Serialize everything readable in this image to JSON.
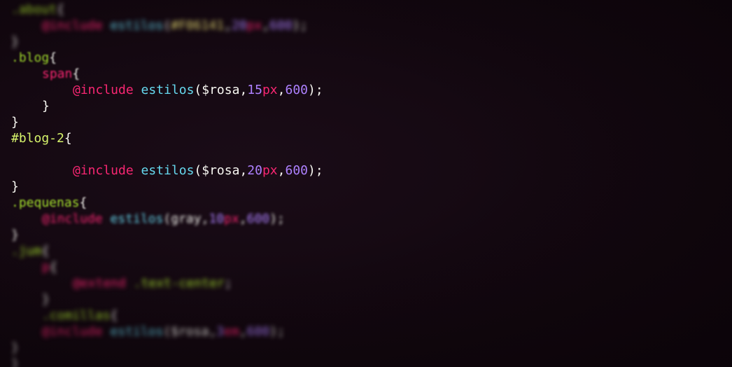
{
  "editor": {
    "lines": [
      {
        "indent": 0,
        "blur": "strong",
        "tokens": [
          {
            "t": ".about",
            "c": "sel"
          },
          {
            "t": "{",
            "c": "punc"
          }
        ]
      },
      {
        "indent": 1,
        "blur": "strong",
        "tokens": [
          {
            "t": "@include",
            "c": "at"
          },
          {
            "t": " ",
            "c": "punc"
          },
          {
            "t": "estilos",
            "c": "fn"
          },
          {
            "t": "(",
            "c": "punc"
          },
          {
            "t": "#F06141",
            "c": "str"
          },
          {
            "t": ",",
            "c": "punc"
          },
          {
            "t": "20",
            "c": "num"
          },
          {
            "t": "px",
            "c": "unit"
          },
          {
            "t": ",",
            "c": "punc"
          },
          {
            "t": "600",
            "c": "num"
          },
          {
            "t": ");",
            "c": "punc"
          }
        ]
      },
      {
        "indent": 0,
        "blur": "strong",
        "tokens": [
          {
            "t": "}",
            "c": "punc"
          }
        ]
      },
      {
        "indent": 0,
        "blur": "light",
        "tokens": [
          {
            "t": ".blog",
            "c": "sel"
          },
          {
            "t": "{",
            "c": "punc"
          }
        ]
      },
      {
        "indent": 1,
        "blur": "light",
        "tokens": [
          {
            "t": "span",
            "c": "tag"
          },
          {
            "t": "{",
            "c": "punc"
          }
        ]
      },
      {
        "indent": 2,
        "blur": "none",
        "tokens": [
          {
            "t": "@include",
            "c": "at"
          },
          {
            "t": " ",
            "c": "punc"
          },
          {
            "t": "estilos",
            "c": "fn"
          },
          {
            "t": "(",
            "c": "punc"
          },
          {
            "t": "$rosa",
            "c": "var"
          },
          {
            "t": ",",
            "c": "punc"
          },
          {
            "t": "15",
            "c": "num"
          },
          {
            "t": "px",
            "c": "unit"
          },
          {
            "t": ",",
            "c": "punc"
          },
          {
            "t": "600",
            "c": "num"
          },
          {
            "t": ");",
            "c": "punc"
          }
        ]
      },
      {
        "indent": 1,
        "blur": "none",
        "tokens": [
          {
            "t": "}",
            "c": "punc"
          }
        ]
      },
      {
        "indent": 0,
        "blur": "none",
        "tokens": [
          {
            "t": "}",
            "c": "punc"
          }
        ]
      },
      {
        "indent": 0,
        "blur": "none",
        "tokens": [
          {
            "t": "#blog-2",
            "c": "id"
          },
          {
            "t": "{",
            "c": "punc"
          }
        ]
      },
      {
        "indent": 2,
        "blur": "none",
        "tokens": []
      },
      {
        "indent": 2,
        "blur": "none",
        "tokens": [
          {
            "t": "@include",
            "c": "at"
          },
          {
            "t": " ",
            "c": "punc"
          },
          {
            "t": "estilos",
            "c": "fn"
          },
          {
            "t": "(",
            "c": "punc"
          },
          {
            "t": "$rosa",
            "c": "var"
          },
          {
            "t": ",",
            "c": "punc"
          },
          {
            "t": "20",
            "c": "num"
          },
          {
            "t": "px",
            "c": "unit"
          },
          {
            "t": ",",
            "c": "punc"
          },
          {
            "t": "600",
            "c": "num"
          },
          {
            "t": ");",
            "c": "punc"
          }
        ]
      },
      {
        "indent": 0,
        "blur": "none",
        "tokens": [
          {
            "t": "}",
            "c": "punc"
          }
        ]
      },
      {
        "indent": 0,
        "blur": "light",
        "tokens": [
          {
            "t": ".pequenas",
            "c": "sel"
          },
          {
            "t": "{",
            "c": "punc"
          }
        ]
      },
      {
        "indent": 1,
        "blur": "mid",
        "tokens": [
          {
            "t": "@include",
            "c": "at"
          },
          {
            "t": " ",
            "c": "punc"
          },
          {
            "t": "estilos",
            "c": "fn"
          },
          {
            "t": "(",
            "c": "punc"
          },
          {
            "t": "gray",
            "c": "var"
          },
          {
            "t": ",",
            "c": "punc"
          },
          {
            "t": "10",
            "c": "num"
          },
          {
            "t": "px",
            "c": "unit"
          },
          {
            "t": ",",
            "c": "punc"
          },
          {
            "t": "600",
            "c": "num"
          },
          {
            "t": ");",
            "c": "punc"
          }
        ]
      },
      {
        "indent": 0,
        "blur": "mid",
        "tokens": [
          {
            "t": "}",
            "c": "punc"
          }
        ]
      },
      {
        "indent": 0,
        "blur": "strong",
        "tokens": [
          {
            "t": ".jum",
            "c": "sel"
          },
          {
            "t": "{",
            "c": "punc"
          }
        ]
      },
      {
        "indent": 1,
        "blur": "strong",
        "tokens": [
          {
            "t": "p",
            "c": "tag"
          },
          {
            "t": "{",
            "c": "punc"
          }
        ]
      },
      {
        "indent": 2,
        "blur": "strong",
        "tokens": [
          {
            "t": "@extend",
            "c": "at"
          },
          {
            "t": " ",
            "c": "punc"
          },
          {
            "t": ".text-center",
            "c": "sel"
          },
          {
            "t": ";",
            "c": "punc"
          }
        ]
      },
      {
        "indent": 1,
        "blur": "strong",
        "tokens": [
          {
            "t": "}",
            "c": "punc"
          }
        ]
      },
      {
        "indent": 1,
        "blur": "strong",
        "tokens": [
          {
            "t": ".comillas",
            "c": "sel"
          },
          {
            "t": "{",
            "c": "punc"
          }
        ]
      },
      {
        "indent": 1,
        "blur": "strong",
        "tokens": [
          {
            "t": "@include",
            "c": "at"
          },
          {
            "t": " ",
            "c": "punc"
          },
          {
            "t": "estilos",
            "c": "fn"
          },
          {
            "t": "(",
            "c": "punc"
          },
          {
            "t": "$rosa",
            "c": "var"
          },
          {
            "t": ",",
            "c": "punc"
          },
          {
            "t": "3",
            "c": "num"
          },
          {
            "t": "em",
            "c": "unit"
          },
          {
            "t": ",",
            "c": "punc"
          },
          {
            "t": "600",
            "c": "num"
          },
          {
            "t": ");",
            "c": "punc"
          }
        ]
      },
      {
        "indent": 0,
        "blur": "strong",
        "tokens": [
          {
            "t": "}",
            "c": "punc"
          }
        ]
      },
      {
        "indent": 0,
        "blur": "strong",
        "tokens": [
          {
            "t": "}",
            "c": "punc"
          }
        ]
      }
    ]
  },
  "colors": {
    "background": "#12070f",
    "selector": "#a6e22e",
    "at_rule": "#f92672",
    "function": "#66d9ef",
    "number": "#ae81ff",
    "unit": "#f92672",
    "string": "#e6db74",
    "text": "#f8f8f2"
  }
}
